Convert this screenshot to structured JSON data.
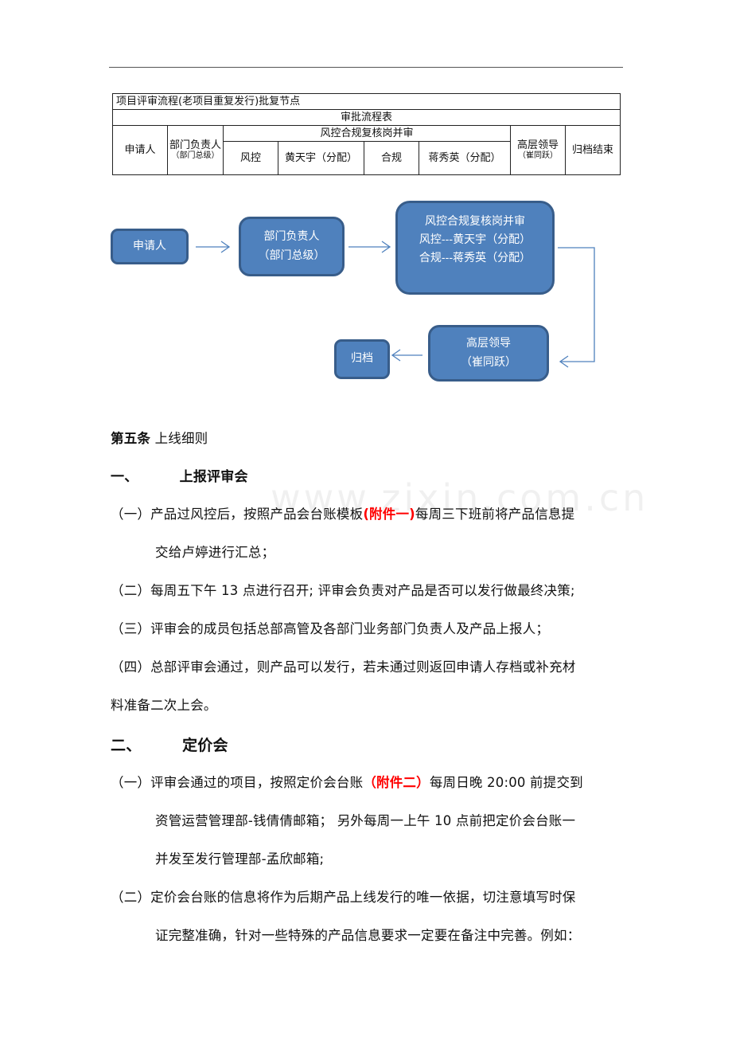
{
  "table": {
    "title": "项目评审流程(老项目重复发行)批复节点",
    "subtitle": "审批流程表",
    "columns": {
      "applicant": "申请人",
      "dept_head": "部门负责人",
      "dept_head_note": "（部门总级）",
      "risk_compliance_group": "风控合规复核岗并审",
      "risk": "风控",
      "risk_person": "黄天宇（分配）",
      "compliance": "合规",
      "compliance_person": "蒋秀英（分配）",
      "senior": "高层领导",
      "senior_note": "（崔同跃）",
      "archive": "归档结束"
    }
  },
  "flowchart": {
    "nodes": {
      "applicant": [
        "申请人"
      ],
      "dept_head": [
        "部门负责人",
        "（部门总级）"
      ],
      "review": [
        "风控合规复核岗并审",
        "风控---黄天宇（分配）",
        "合规---蒋秀英（分配）"
      ],
      "senior": [
        "高层领导",
        "（崔同跃）"
      ],
      "archive": [
        "归档"
      ]
    },
    "colors": {
      "fill": "#4f81bd",
      "border": "#385d8a",
      "arrow": "#4f81bd"
    }
  },
  "article": {
    "label": "第五条",
    "title": "上线细则"
  },
  "sections": [
    {
      "number": "一、",
      "title": "上报评审会",
      "items": [
        {
          "prefix": "（一）",
          "before": "产品过风控后，按照产品会台账模板",
          "highlight": "(附件一)",
          "after": "每周三下班前将产品信息提",
          "cont": "交给卢婷进行汇总；"
        },
        {
          "prefix": "（二）",
          "text": "每周五下午 13 点进行召开; 评审会负责对产品是否可以发行做最终决策;"
        },
        {
          "prefix": "（三）",
          "text": "评审会的成员包括总部高管及各部门业务部门负责人及产品上报人；"
        },
        {
          "prefix": "（四）",
          "text": "总部评审会通过，则产品可以发行，若未通过则返回申请人存档或补充材",
          "cont": "料准备二次上会。"
        }
      ]
    },
    {
      "number": "二、",
      "title": "定价会",
      "items": [
        {
          "prefix": "（一）",
          "before": "评审会通过的项目，按照定价会台账",
          "highlight": "（附件二）",
          "after": "每周日晚 20:00 前提交到",
          "cont": "资管运营管理部-钱倩倩邮箱； 另外每周一上午 10 点前把定价会台账一",
          "cont2": "并发至发行管理部-孟欣邮箱;"
        },
        {
          "prefix": "（二）",
          "text": "定价会台账的信息将作为后期产品上线发行的唯一依据，切注意填写时保",
          "cont": "证完整准确，针对一些特殊的产品信息要求一定要在备注中完善。例如："
        }
      ]
    }
  ],
  "watermark": "www.zixin.com.cn",
  "colors": {
    "highlight": "#ff0000"
  }
}
